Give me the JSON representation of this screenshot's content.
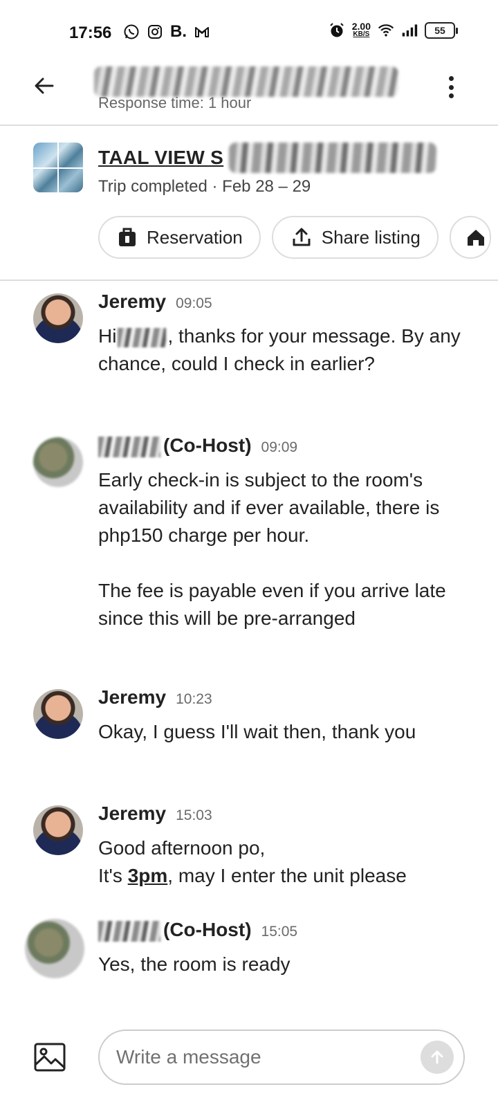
{
  "status_bar": {
    "time": "17:56",
    "left_icons": [
      "whatsapp-icon",
      "instagram-icon",
      "booking-icon",
      "gmail-icon"
    ],
    "booking_letter": "B.",
    "net_speed_value": "2.00",
    "net_speed_unit": "KB/S",
    "battery": "55"
  },
  "header": {
    "response_time": "Response time: 1 hour"
  },
  "listing": {
    "title": "TAAL VIEW S",
    "trip_status": "Trip completed · Feb 28 – 29",
    "chips": [
      {
        "label": "Reservation",
        "icon": "suitcase-icon"
      },
      {
        "label": "Share listing",
        "icon": "share-icon"
      },
      {
        "label": "",
        "icon": "home-icon"
      }
    ]
  },
  "messages": [
    {
      "sender": "Jeremy",
      "time": "09:05",
      "body_prefix": "Hi",
      "body": ", thanks for your message. By any chance, could I check in earlier?"
    },
    {
      "sender": "(Co-Host)",
      "time": "09:09",
      "body": "Early check-in is subject to the room's availability and if ever available, there is php150 charge per hour.\n\nThe fee is payable even if you arrive late since this will be pre-arranged"
    },
    {
      "sender": "Jeremy",
      "time": "10:23",
      "body": "Okay, I guess I'll wait then, thank you"
    },
    {
      "sender": "Jeremy",
      "time": "15:03",
      "body_line1": "Good afternoon po,",
      "body_line2_pre": "It's ",
      "body_line2_link": "3pm",
      "body_line2_post": ", may I enter the unit please"
    },
    {
      "sender": "(Co-Host)",
      "time": "15:05",
      "body": "Yes, the room is ready"
    }
  ],
  "composer": {
    "placeholder": "Write a message"
  }
}
